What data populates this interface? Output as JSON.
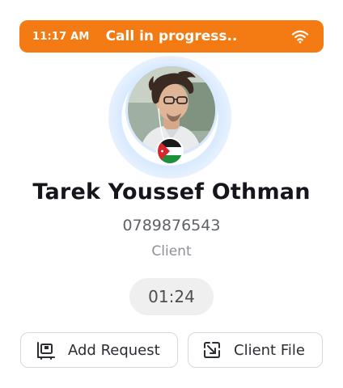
{
  "status_bar": {
    "time": "11:17 AM",
    "title": "Call in progress..",
    "icon": "wifi-icon",
    "color": "#f47b14"
  },
  "caller": {
    "name": "Tarek Youssef Othman",
    "phone": "0789876543",
    "role": "Client",
    "flag_icon": "jordan-flag-icon"
  },
  "call": {
    "duration": "01:24"
  },
  "actions": {
    "add_request_label": "Add Request",
    "client_file_label": "Client File"
  }
}
